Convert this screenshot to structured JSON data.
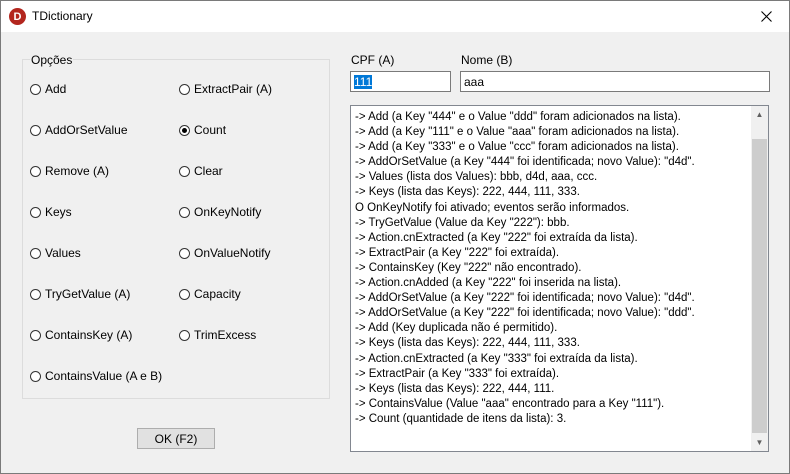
{
  "window": {
    "title": "TDictionary",
    "icon_letter": "D",
    "icon_color": "#b3261e"
  },
  "options": {
    "group_label": "Opções",
    "left": [
      {
        "label": "Add",
        "checked": false
      },
      {
        "label": "AddOrSetValue",
        "checked": false
      },
      {
        "label": "Remove (A)",
        "checked": false
      },
      {
        "label": "Keys",
        "checked": false
      },
      {
        "label": "Values",
        "checked": false
      },
      {
        "label": "TryGetValue (A)",
        "checked": false
      },
      {
        "label": "ContainsKey (A)",
        "checked": false
      },
      {
        "label": "ContainsValue (A e B)",
        "checked": false
      }
    ],
    "right": [
      {
        "label": "ExtractPair (A)",
        "checked": false
      },
      {
        "label": "Count",
        "checked": true
      },
      {
        "label": "Clear",
        "checked": false
      },
      {
        "label": "OnKeyNotify",
        "checked": false
      },
      {
        "label": "OnValueNotify",
        "checked": false
      },
      {
        "label": "Capacity",
        "checked": false
      },
      {
        "label": "TrimExcess",
        "checked": false
      }
    ]
  },
  "ok_button": "OK (F2)",
  "fields": {
    "cpf_label": "CPF (A)",
    "cpf_value": "111",
    "nome_label": "Nome (B)",
    "nome_value": "aaa"
  },
  "log": [
    "-> Add (a Key \"444\" e o Value \"ddd\" foram adicionados na lista).",
    "-> Add (a Key \"111\" e o Value \"aaa\" foram adicionados na lista).",
    "-> Add (a Key \"333\" e o Value \"ccc\" foram adicionados na lista).",
    "-> AddOrSetValue (a Key \"444\" foi identificada; novo Value): \"d4d\".",
    "-> Values (lista dos Values): bbb, d4d, aaa, ccc.",
    "-> Keys (lista das Keys): 222, 444, 111, 333.",
    "O OnKeyNotify foi ativado; eventos serão informados.",
    "-> TryGetValue (Value da Key \"222\"): bbb.",
    "-> Action.cnExtracted (a Key \"222\" foi extraída da lista).",
    "-> ExtractPair (a Key \"222\" foi extraída).",
    "-> ContainsKey (Key \"222\" não encontrado).",
    "-> Action.cnAdded (a Key \"222\" foi inserida na lista).",
    "-> AddOrSetValue (a Key \"222\" foi identificada; novo Value): \"d4d\".",
    "-> AddOrSetValue (a Key \"222\" foi identificada; novo Value): \"ddd\".",
    "-> Add (Key duplicada não é permitido).",
    "-> Keys (lista das Keys): 222, 444, 111, 333.",
    "-> Action.cnExtracted (a Key \"333\" foi extraída da lista).",
    "-> ExtractPair (a Key \"333\" foi extraída).",
    "-> Keys (lista das Keys): 222, 444, 111.",
    "-> ContainsValue (Value \"aaa\" encontrado para a Key \"111\").",
    "-> Count (quantidade de itens da lista): 3."
  ]
}
